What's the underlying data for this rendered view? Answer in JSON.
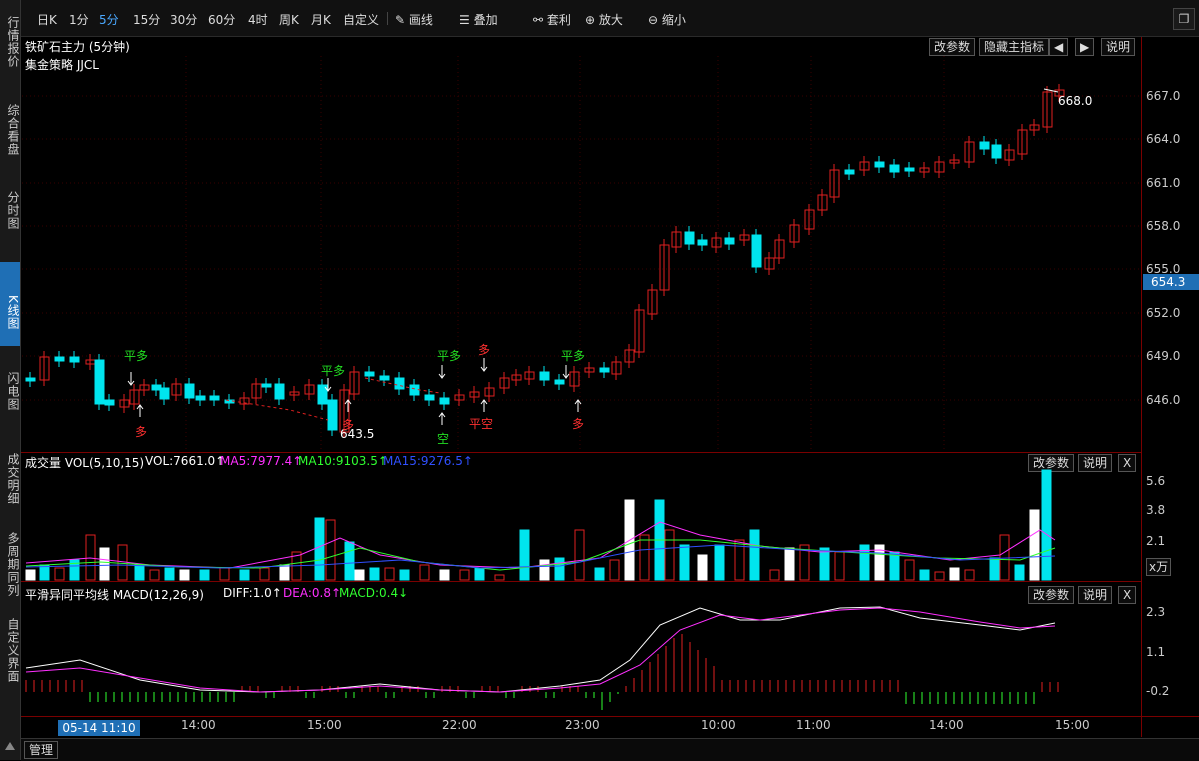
{
  "sidebar": {
    "tabs": [
      "行情报价",
      "综合看盘",
      "分时图",
      "K线图",
      "闪电图",
      "成交明细",
      "多周期同列",
      "自定义界面"
    ],
    "active_index": 3
  },
  "toolbar": {
    "periods": [
      "日K",
      "1分",
      "5分",
      "15分",
      "30分",
      "60分",
      "4时",
      "周K",
      "月K",
      "自定义"
    ],
    "active_period": "5分",
    "tools": [
      "画线",
      "叠加",
      "套利",
      "放大",
      "缩小"
    ],
    "tool_icons": [
      "pencil-icon",
      "stack-icon",
      "link-icon",
      "zoom-in-icon",
      "zoom-out-icon"
    ]
  },
  "main": {
    "title": "铁矿石主力 (5分钟)",
    "strategy": "集金策略 JJCL",
    "buttons": [
      "改参数",
      "隐藏主指标",
      "◀",
      "▶",
      "说明"
    ],
    "price_axis": [
      "667.0",
      "664.0",
      "661.0",
      "658.0",
      "655.0",
      "652.0",
      "649.0",
      "646.0"
    ],
    "current_price": "654.3",
    "high_label": "668.0",
    "low_label": "643.5",
    "signals": [
      {
        "text": "平多",
        "color": "#22dd22"
      },
      {
        "text": "多",
        "color": "#ff3030"
      },
      {
        "text": "平多",
        "color": "#22dd22"
      },
      {
        "text": "多",
        "color": "#ff3030"
      },
      {
        "text": "平多",
        "color": "#22dd22"
      },
      {
        "text": "空",
        "color": "#22dd22"
      },
      {
        "text": "多",
        "color": "#ff3030"
      },
      {
        "text": "平空",
        "color": "#ff3030"
      },
      {
        "text": "平多",
        "color": "#22dd22"
      },
      {
        "text": "多",
        "color": "#ff3030"
      }
    ]
  },
  "volume": {
    "title": "成交量 VOL(5,10,15)",
    "vol": "VOL:7661.0↑",
    "ma5": "MA5:7977.4↑",
    "ma10": "MA10:9103.5↑",
    "ma15": "MA15:9276.5↑",
    "buttons": [
      "改参数",
      "说明",
      "X"
    ],
    "axis": [
      "5.6",
      "3.8",
      "2.1"
    ],
    "unit": "x万"
  },
  "macd": {
    "title": "平滑异同平均线 MACD(12,26,9)",
    "diff": "DIFF:1.0↑",
    "dea": "DEA:0.8↑",
    "macd": "MACD:0.4↓",
    "buttons": [
      "改参数",
      "说明",
      "X"
    ],
    "axis": [
      "2.3",
      "1.1",
      "-0.2"
    ]
  },
  "time_axis": {
    "highlight": "05-14 11:10",
    "labels": [
      "14:00",
      "15:00",
      "22:00",
      "23:00",
      "10:00",
      "11:00",
      "14:00",
      "15:00"
    ]
  },
  "bottom": {
    "manage": "管理"
  },
  "colors": {
    "up": "#e02020",
    "down": "#00e5ee",
    "ma5": "#ff30ff",
    "ma10": "#30ff30",
    "ma15": "#3050ff",
    "accent": "#1f6fb5"
  }
}
